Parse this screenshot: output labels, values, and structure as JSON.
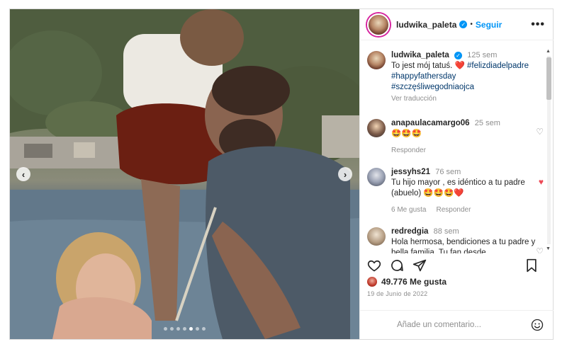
{
  "post": {
    "author": "ludwika_paleta",
    "follow_label": "Seguir",
    "more_label": "•••",
    "carousel": {
      "slide_count": 7,
      "active_slide": 4
    }
  },
  "caption": {
    "user": "ludwika_paleta",
    "time": "125 sem",
    "text": "To jest mój tatuś. ❤️",
    "hashtags": [
      "#felizdiadelpadre",
      "#happyfathersday",
      "#szczęśliwegodniaojca"
    ],
    "translate_label": "Ver traducción"
  },
  "comments": [
    {
      "user": "anapaulacamargo06",
      "time": "25 sem",
      "text": "🤩🤩🤩",
      "meta": [
        "Responder"
      ],
      "liked": false
    },
    {
      "user": "jessyhs21",
      "time": "76 sem",
      "text": "Tu hijo mayor , es idéntico a tu padre (abuelo) 🤩🤩🤩❤️",
      "meta": [
        "6 Me gusta",
        "Responder"
      ],
      "liked": true
    },
    {
      "user": "redredgia",
      "time": "88 sem",
      "text": "Hola hermosa, bendiciones a tu padre y bella familia. Tu fan desde",
      "meta": [],
      "liked": false
    }
  ],
  "likes": {
    "count_label": "49.776 Me gusta"
  },
  "date": "19 de Junio de 2022",
  "composer": {
    "placeholder": "Añade un comentario..."
  },
  "colors": {
    "link": "#0095f6",
    "liked": "#ed4956",
    "text": "#262626",
    "muted": "#8e8e8e"
  }
}
